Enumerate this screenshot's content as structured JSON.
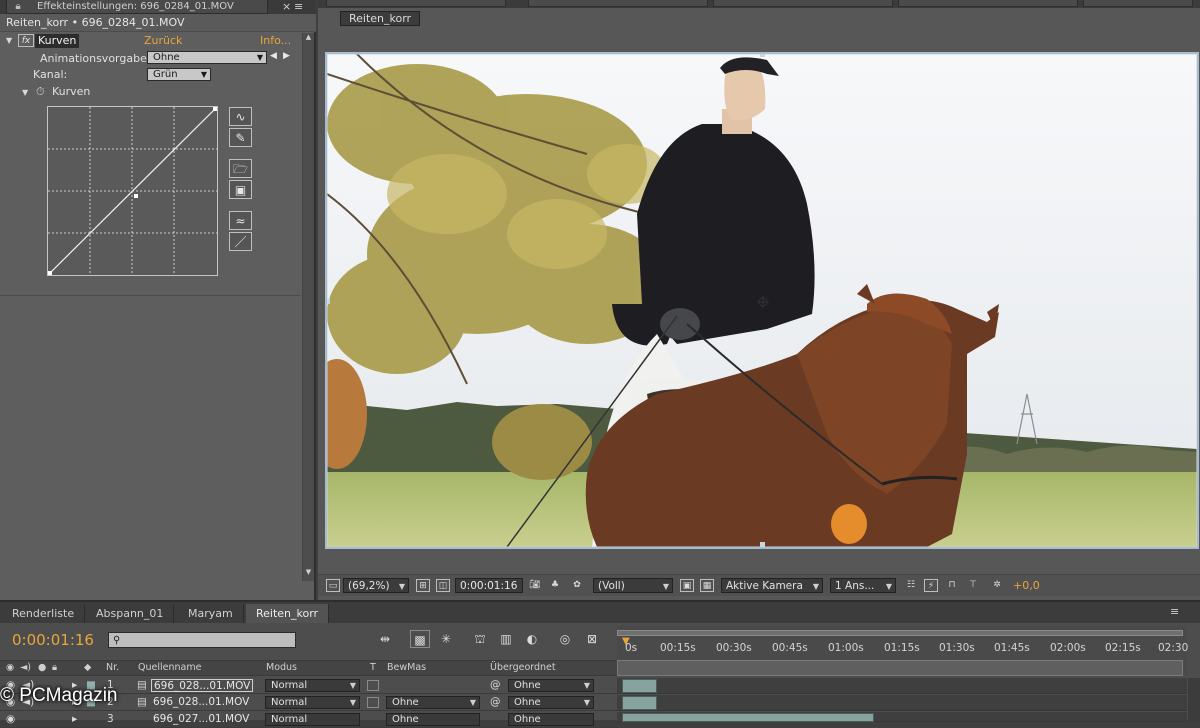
{
  "effect_panel": {
    "tab_title": "Effekteinstellungen: 696_0284_01.MOV",
    "layer_title": "Reiten_korr • 696_0284_01.MOV",
    "fx_badge": "fx",
    "effect_name": "Kurven",
    "reset_label": "Zurück",
    "about_label": "Info...",
    "anim_preset_label": "Animationsvorgabe",
    "anim_preset_value": "Ohne",
    "channel_label": "Kanal:",
    "channel_value": "Grün",
    "curves_label": "Kurven"
  },
  "composition": {
    "breadcrumb": "Reiten_korr",
    "zoom": "(69,2%)",
    "timecode": "0:00:01:16",
    "resolution": "(Voll)",
    "camera": "Aktive Kamera",
    "views": "1 Ans...",
    "exposure": "+0,0"
  },
  "timeline": {
    "tabs": [
      "Renderliste",
      "Abspann_01",
      "Maryam",
      "Reiten_korr"
    ],
    "current_time": "0:00:01:16",
    "search_placeholder": "",
    "ticks": [
      "0s",
      "00:15s",
      "00:30s",
      "00:45s",
      "01:00s",
      "01:15s",
      "01:30s",
      "01:45s",
      "02:00s",
      "02:15s",
      "02:30"
    ],
    "columns": {
      "nr": "Nr.",
      "source": "Quellenname",
      "mode": "Modus",
      "t": "T",
      "trkmat": "BewMas",
      "parent": "Übergeordnet"
    },
    "layers": [
      {
        "nr": "1",
        "source": "696_028...01.MOV",
        "mode": "Normal",
        "trkmat": "",
        "parent": "Ohne"
      },
      {
        "nr": "2",
        "source": "696_028...01.MOV",
        "mode": "Normal",
        "trkmat": "Ohne",
        "parent": "Ohne"
      },
      {
        "nr": "3",
        "source": "696_027...01.MOV",
        "mode": "Normal",
        "trkmat": "Ohne",
        "parent": "Ohne"
      }
    ]
  },
  "watermark": "© PCMagazin",
  "colors": {
    "accent": "#e8a63a",
    "panel": "#5e5e5e",
    "layer_bar": "#86a3a0"
  }
}
